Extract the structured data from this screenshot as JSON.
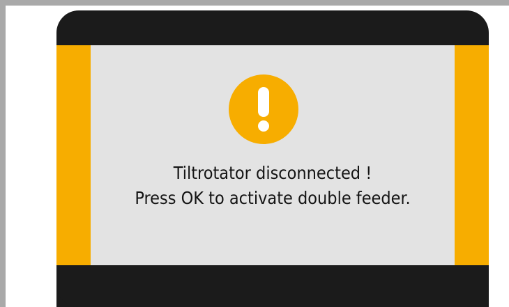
{
  "dialog": {
    "message_line_1": "Tiltrotator disconnected !",
    "message_line_2": "Press OK to activate double feeder.",
    "icon": "warning-exclamation-icon"
  },
  "colors": {
    "frame_border": "#a9a9a9",
    "dialog_background": "#1b1b1b",
    "content_background": "#e3e3e3",
    "accent": "#f7ad00",
    "text": "#141414",
    "icon_mark": "#ffffff"
  }
}
